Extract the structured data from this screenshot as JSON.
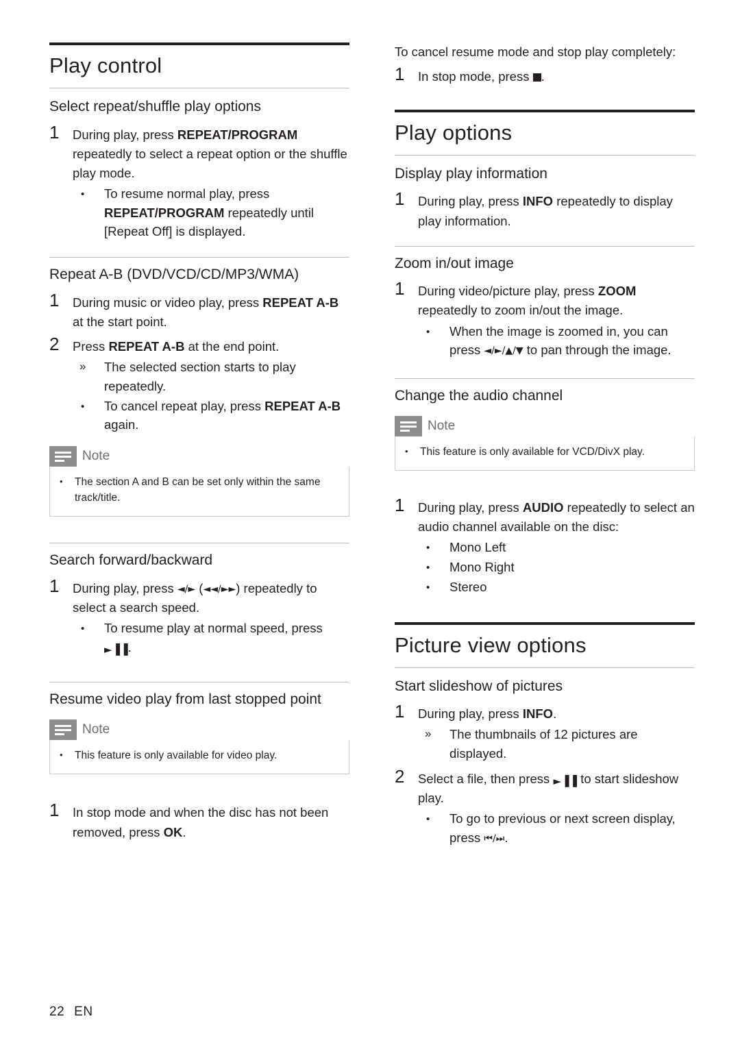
{
  "page": {
    "number": "22",
    "locale": "EN"
  },
  "left": {
    "title": "Play control",
    "s1": {
      "heading": "Select repeat/shuffle play options",
      "step1_num": "1",
      "step1_a": "During play, press ",
      "step1_b": "REPEAT/PROGRAM",
      "step1_c": " repeatedly to select a repeat option or the shuffle play mode.",
      "b1_a": "To resume normal play, press ",
      "b1_b": "REPEAT/PROGRAM",
      "b1_c": " repeatedly until [Repeat Off] is displayed."
    },
    "s2": {
      "heading": "Repeat A-B (DVD/VCD/CD/MP3/WMA)",
      "step1_num": "1",
      "step1_a": "During music or video play, press ",
      "step1_b": "REPEAT A-B",
      "step1_c": " at the start point.",
      "step2_num": "2",
      "step2_a": "Press ",
      "step2_b": "REPEAT A-B",
      "step2_c": " at the end point.",
      "arrow1": "The selected section starts to play repeatedly.",
      "b1_a": "To cancel repeat play, press ",
      "b1_b": "REPEAT A-B",
      "b1_c": " again.",
      "note_label": "Note",
      "note_text": "The section A and B can be set only within the same track/title."
    },
    "s3": {
      "heading": "Search forward/backward",
      "step1_num": "1",
      "step1_a": "During play, press ",
      "step1_sym": "◄/►",
      "step1_b": " (",
      "step1_sym2": "◄◄/►►",
      "step1_c": ") repeatedly to select a search speed.",
      "b1_a": "To resume play at normal speed, press ",
      "b1_sym": "►▐▐",
      "b1_c": "."
    },
    "s4": {
      "heading": "Resume video play from last stopped point",
      "note_label": "Note",
      "note_text": "This feature is only available for video play.",
      "step1_num": "1",
      "step1_a": "In stop mode and when the disc has not been removed, press ",
      "step1_b": "OK",
      "step1_c": "."
    }
  },
  "right": {
    "top": {
      "para": "To cancel resume mode and stop play completely:",
      "step1_num": "1",
      "step1_a": "In stop mode, press ",
      "step1_c": "."
    },
    "title1": "Play options",
    "s1": {
      "heading": "Display play information",
      "step1_num": "1",
      "step1_a": "During play, press ",
      "step1_b": "INFO",
      "step1_c": " repeatedly to display play information."
    },
    "s2": {
      "heading": "Zoom in/out image",
      "step1_num": "1",
      "step1_a": "During video/picture play, press ",
      "step1_b": "ZOOM",
      "step1_c": " repeatedly to zoom in/out the image.",
      "b1_a": "When the image is zoomed in, you can press ",
      "b1_sym": "◄/►/▲/▼",
      "b1_c": " to pan through the image."
    },
    "s3": {
      "heading": "Change the audio channel",
      "note_label": "Note",
      "note_text": "This feature is only available for VCD/DivX play.",
      "step1_num": "1",
      "step1_a": "During play, press ",
      "step1_b": "AUDIO",
      "step1_c": " repeatedly to select an audio channel available on the disc:",
      "opt1": "Mono Left",
      "opt2": "Mono Right",
      "opt3": "Stereo"
    },
    "title2": "Picture view options",
    "s4": {
      "heading": "Start slideshow of pictures",
      "step1_num": "1",
      "step1_a": "During play, press ",
      "step1_b": "INFO",
      "step1_c": ".",
      "arrow1": "The thumbnails of 12 pictures are displayed.",
      "step2_num": "2",
      "step2_a": "Select a file, then press ",
      "step2_sym": "►▐▐",
      "step2_c": " to start slideshow play.",
      "b1_a": "To go to previous or next screen display, press ",
      "b1_sym": "⏮/⏭",
      "b1_c": "."
    }
  }
}
